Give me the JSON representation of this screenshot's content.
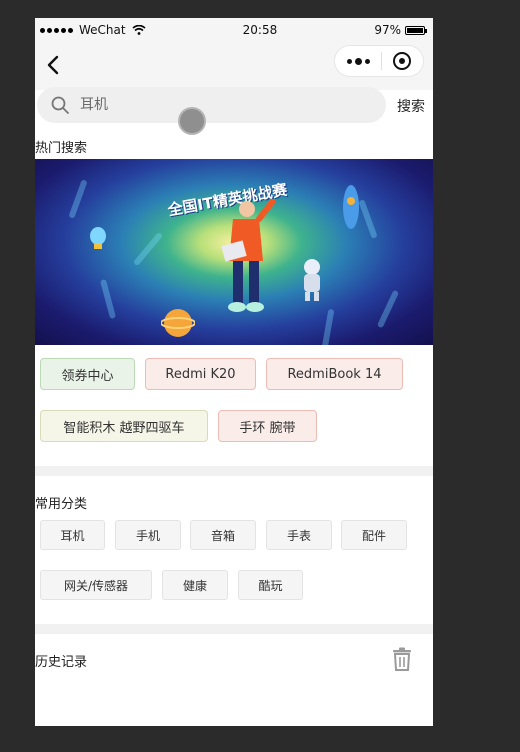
{
  "status_bar": {
    "carrier": "WeChat",
    "time": "20:58",
    "battery": "97%"
  },
  "search": {
    "placeholder": "耳机",
    "button_label": "搜索"
  },
  "hot_search": {
    "title": "热门搜索",
    "banner_text": "全国IT精英挑战赛",
    "tags": [
      "领券中心",
      "Redmi K20",
      "RedmiBook 14",
      "智能积木 越野四驱车",
      "手环 腕带"
    ]
  },
  "categories": {
    "title": "常用分类",
    "items": [
      "耳机",
      "手机",
      "音箱",
      "手表",
      "配件",
      "网关/传感器",
      "健康",
      "酷玩"
    ]
  },
  "history": {
    "title": "历史记录"
  },
  "icons": {
    "back": "chevron-left-icon",
    "more": "more-dots-icon",
    "close": "target-circle-icon",
    "search": "search-icon",
    "delete": "trash-icon"
  },
  "colors": {
    "tag_green": "#e9f3e7",
    "tag_pink": "#faece9",
    "tag_beige": "#f5f5e8",
    "search_bg": "#efefef"
  }
}
